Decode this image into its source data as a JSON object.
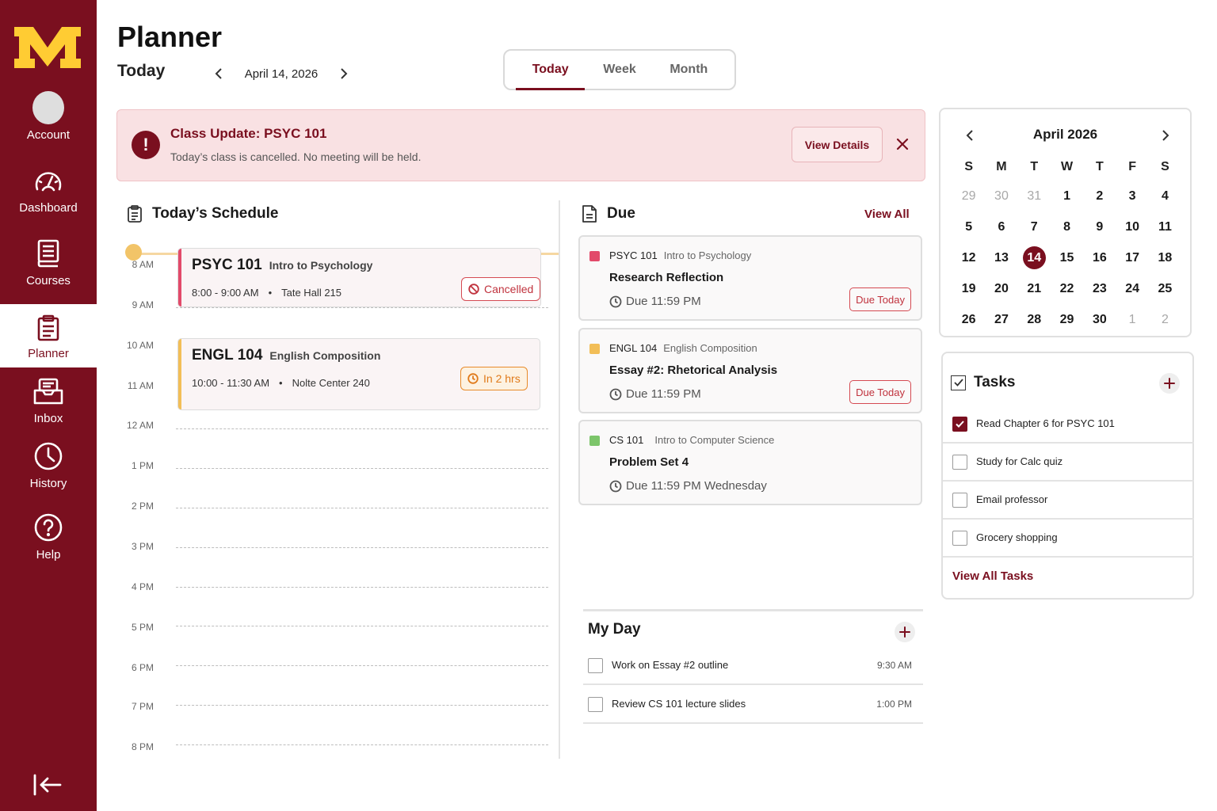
{
  "colors": {
    "brand": "#7a0f1f",
    "gold": "#ffcc33",
    "alert_bg": "#f9e1e3",
    "psyc": "#e24a6a",
    "engl": "#f2be57",
    "cs": "#7cc56a",
    "cancelled": "#d54a52",
    "soon": "#e88b2a"
  },
  "sidebar": {
    "logo_icon": "university-m-logo",
    "items": [
      {
        "label": "Account",
        "icon": "avatar"
      },
      {
        "label": "Dashboard",
        "icon": "gauge-icon"
      },
      {
        "label": "Courses",
        "icon": "book-icon"
      },
      {
        "label": "Planner",
        "icon": "clipboard-icon",
        "active": true
      },
      {
        "label": "Inbox",
        "icon": "inbox-icon"
      },
      {
        "label": "History",
        "icon": "clock-icon"
      },
      {
        "label": "Help",
        "icon": "help-icon"
      }
    ],
    "collapse_icon": "collapse-left-icon"
  },
  "header": {
    "title": "Planner",
    "subtitle": "Today",
    "date": "April 14, 2026",
    "tabs": [
      {
        "label": "Today",
        "active": true
      },
      {
        "label": "Week"
      },
      {
        "label": "Month"
      }
    ]
  },
  "alert": {
    "icon": "exclamation-icon",
    "title": "Class Update: PSYC 101",
    "message": "Today’s class is cancelled. No meeting will be held.",
    "button": "View Details"
  },
  "schedule": {
    "title": "Today’s Schedule",
    "hours": [
      "8 AM",
      "9 AM",
      "10 AM",
      "11 AM",
      "12 AM",
      "1 PM",
      "2 PM",
      "3 PM",
      "4 PM",
      "5 PM",
      "6 PM",
      "7 PM",
      "8 PM"
    ],
    "events": [
      {
        "code": "PSYC 101",
        "name": "Intro to Psychology",
        "time": "8:00 - 9:00 AM",
        "room": "Tate Hall 215",
        "badge": "Cancelled"
      },
      {
        "code": "ENGL 104",
        "name": "English Composition",
        "time": "10:00 - 11:30 AM",
        "room": "Nolte Center 240",
        "badge": "In 2 hrs"
      }
    ]
  },
  "due": {
    "title": "Due",
    "view_all": "View All",
    "items": [
      {
        "code": "PSYC 101",
        "course": "Intro to Psychology",
        "title": "Research Reflection",
        "time": "Due 11:59 PM",
        "badge": "Due Today"
      },
      {
        "code": "ENGL 104",
        "course": "English Composition",
        "title": "Essay #2: Rhetorical Analysis",
        "time": "Due 11:59 PM",
        "badge": "Due Today"
      },
      {
        "code": "CS 101",
        "course": "Intro to Computer Science",
        "title": "Problem Set 4",
        "time": "Due 11:59 PM Wednesday"
      }
    ]
  },
  "myday": {
    "title": "My Day",
    "items": [
      {
        "text": "Work on Essay #2 outline",
        "time": "9:30 AM"
      },
      {
        "text": "Review CS 101 lecture slides",
        "time": "1:00 PM"
      }
    ]
  },
  "calendar": {
    "month": "April 2026",
    "dow": [
      "S",
      "M",
      "T",
      "W",
      "T",
      "F",
      "S"
    ],
    "days": [
      "29",
      "30",
      "31",
      "1",
      "2",
      "3",
      "4",
      "5",
      "6",
      "7",
      "8",
      "9",
      "10",
      "11",
      "12",
      "13",
      "14",
      "15",
      "16",
      "17",
      "18",
      "19",
      "20",
      "21",
      "22",
      "23",
      "24",
      "25",
      "26",
      "27",
      "28",
      "29",
      "30",
      "1",
      "2"
    ],
    "selected": "14"
  },
  "tasks": {
    "title": "Tasks",
    "items": [
      {
        "text": "Read Chapter 6 for PSYC 101",
        "checked": true
      },
      {
        "text": "Study for Calc quiz",
        "checked": false
      },
      {
        "text": "Email professor",
        "checked": false
      },
      {
        "text": "Grocery shopping",
        "checked": false
      }
    ],
    "link": "View All Tasks"
  }
}
